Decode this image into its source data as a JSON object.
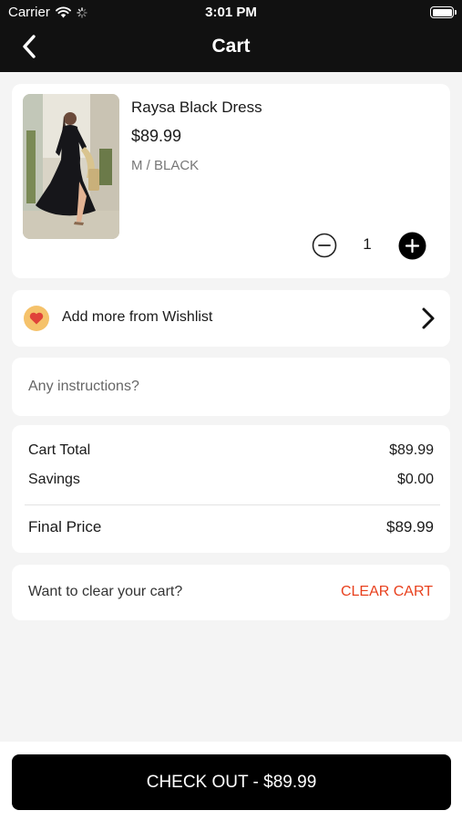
{
  "status_bar": {
    "carrier": "Carrier",
    "time": "3:01 PM",
    "icons": [
      "wifi-icon",
      "activity-spinner-icon",
      "battery-icon"
    ]
  },
  "nav": {
    "title": "Cart",
    "back_icon": "chevron-left-icon"
  },
  "cart_item": {
    "name": "Raysa Black Dress",
    "price": "$89.99",
    "variant": "M / BLACK",
    "quantity": "1",
    "image_description_icon": "product-photo-black-dress"
  },
  "wishlist": {
    "label": "Add more from Wishlist",
    "icon": "heart-icon",
    "accent_color": "#f5c26b",
    "heart_color": "#e0433a"
  },
  "instructions": {
    "placeholder": "Any instructions?"
  },
  "summary": {
    "cart_total_label": "Cart Total",
    "cart_total_value": "$89.99",
    "savings_label": "Savings",
    "savings_value": "$0.00",
    "final_label": "Final Price",
    "final_value": "$89.99"
  },
  "clear": {
    "question": "Want to clear your cart?",
    "button_label": "CLEAR CART",
    "button_color": "#e8401d"
  },
  "checkout": {
    "label": "CHECK OUT - $89.99"
  }
}
